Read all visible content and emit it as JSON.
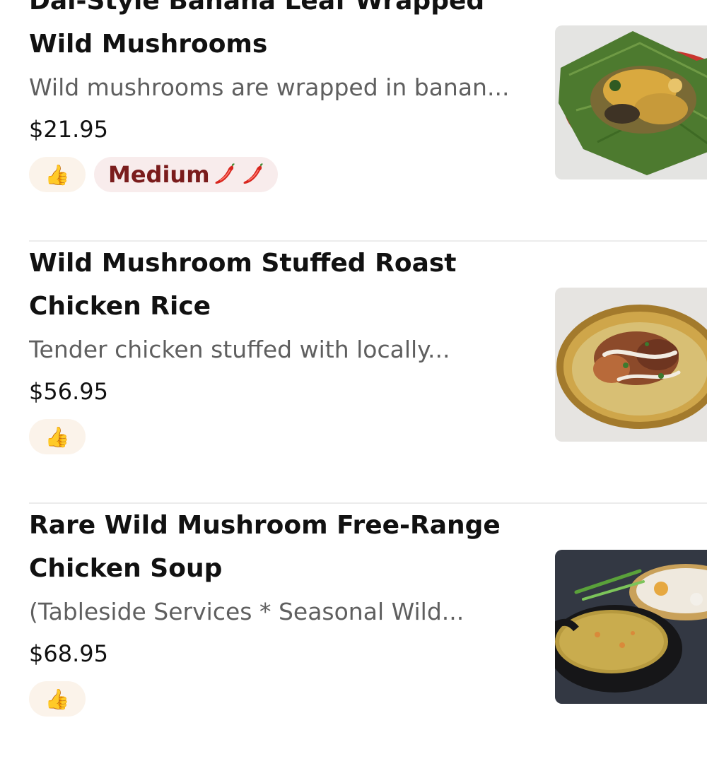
{
  "items": [
    {
      "title": "Dai-Style Banana Leaf Wrapped Wild Mushrooms",
      "description": "Wild mushrooms are wrapped in banan...",
      "price": "$21.95",
      "badges": [
        "thumbs-up-icon",
        "Medium"
      ],
      "spice_label": "Medium",
      "spice_icons": [
        "chili-pepper-icon",
        "chili-pepper-icon"
      ],
      "photo": "banana-leaf-mushroom-dish"
    },
    {
      "title": "Wild Mushroom Stuffed Roast Chicken Rice",
      "description": "Tender chicken stuffed with locally...",
      "price": "$56.95",
      "badges": [
        "thumbs-up-icon"
      ],
      "photo": "roast-chicken-rice-pan"
    },
    {
      "title": "Rare Wild Mushroom Free-Range Chicken Soup",
      "description": "(Tableside Services * Seasonal Wild...",
      "price": "$68.95",
      "badges": [
        "thumbs-up-icon"
      ],
      "photo": "chicken-soup-clay-pot"
    }
  ],
  "colors": {
    "title": "#111111",
    "description": "#5f5f5f",
    "like_badge_bg": "#fbf3ea",
    "spice_badge_bg": "#f8ecec",
    "spice_text": "#7a1c1c",
    "divider": "#ececec"
  }
}
